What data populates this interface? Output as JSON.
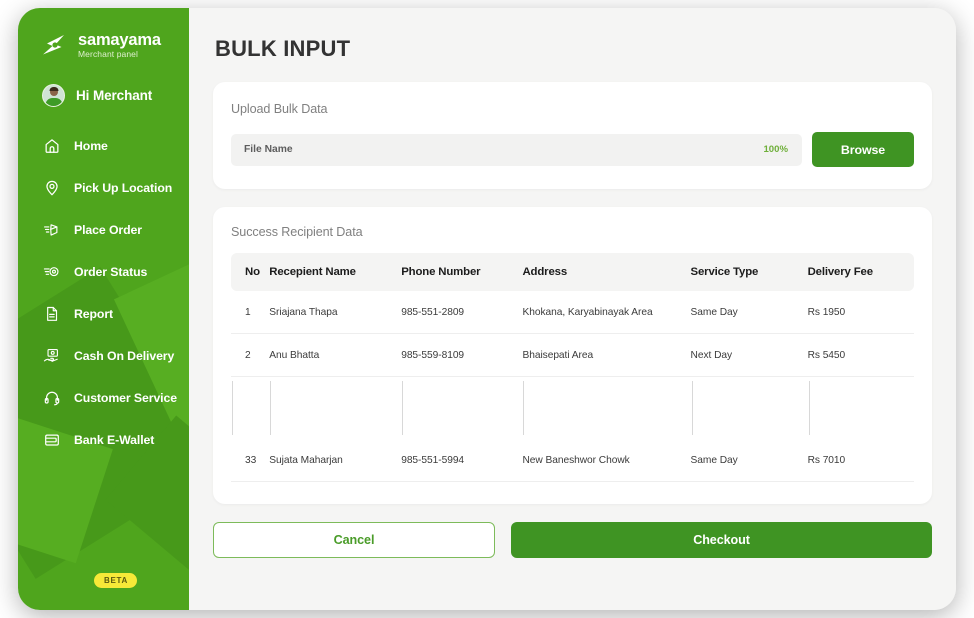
{
  "brand": {
    "name": "samayama",
    "subtitle": "Merchant panel",
    "logo_icon": "lightning-bolt-logo-icon"
  },
  "sidebar": {
    "greeting": "Hi Merchant",
    "avatar_icon": "user-avatar",
    "background_color": "#4fa51d",
    "beta_badge": "BETA",
    "items": [
      {
        "label": "Home",
        "icon": "home-icon"
      },
      {
        "label": "Pick Up Location",
        "icon": "map-pin-icon"
      },
      {
        "label": "Place Order",
        "icon": "package-send-icon"
      },
      {
        "label": "Order Status",
        "icon": "location-track-icon"
      },
      {
        "label": "Report",
        "icon": "document-icon"
      },
      {
        "label": "Cash On Delivery",
        "icon": "cash-hand-icon"
      },
      {
        "label": "Customer Service",
        "icon": "headset-icon"
      },
      {
        "label": "Bank E-Wallet",
        "icon": "wallet-icon"
      }
    ]
  },
  "page": {
    "title": "BULK INPUT"
  },
  "upload": {
    "heading": "Upload Bulk Data",
    "file_name": "File Name",
    "progress": "100%",
    "browse_label": "Browse",
    "accent_color": "#3f9423"
  },
  "table_section": {
    "heading": "Success Recipient Data",
    "columns": [
      "No",
      "Recepient Name",
      "Phone Number",
      "Address",
      "Service Type",
      "Delivery Fee"
    ],
    "rows": [
      {
        "no": "1",
        "name": "Sriajana Thapa",
        "phone": "985-551-2809",
        "address": "Khokana, Karyabinayak Area",
        "service": "Same Day",
        "fee": "Rs 1950"
      },
      {
        "no": "2",
        "name": "Anu Bhatta",
        "phone": "985-559-8109",
        "address": "Bhaisepati Area",
        "service": "Next Day",
        "fee": "Rs 5450"
      },
      {
        "no": "33",
        "name": "Sujata Maharjan",
        "phone": "985-551-5994",
        "address": "New Baneshwor Chowk",
        "service": "Same Day",
        "fee": "Rs 7010"
      }
    ]
  },
  "actions": {
    "cancel_label": "Cancel",
    "checkout_label": "Checkout"
  }
}
